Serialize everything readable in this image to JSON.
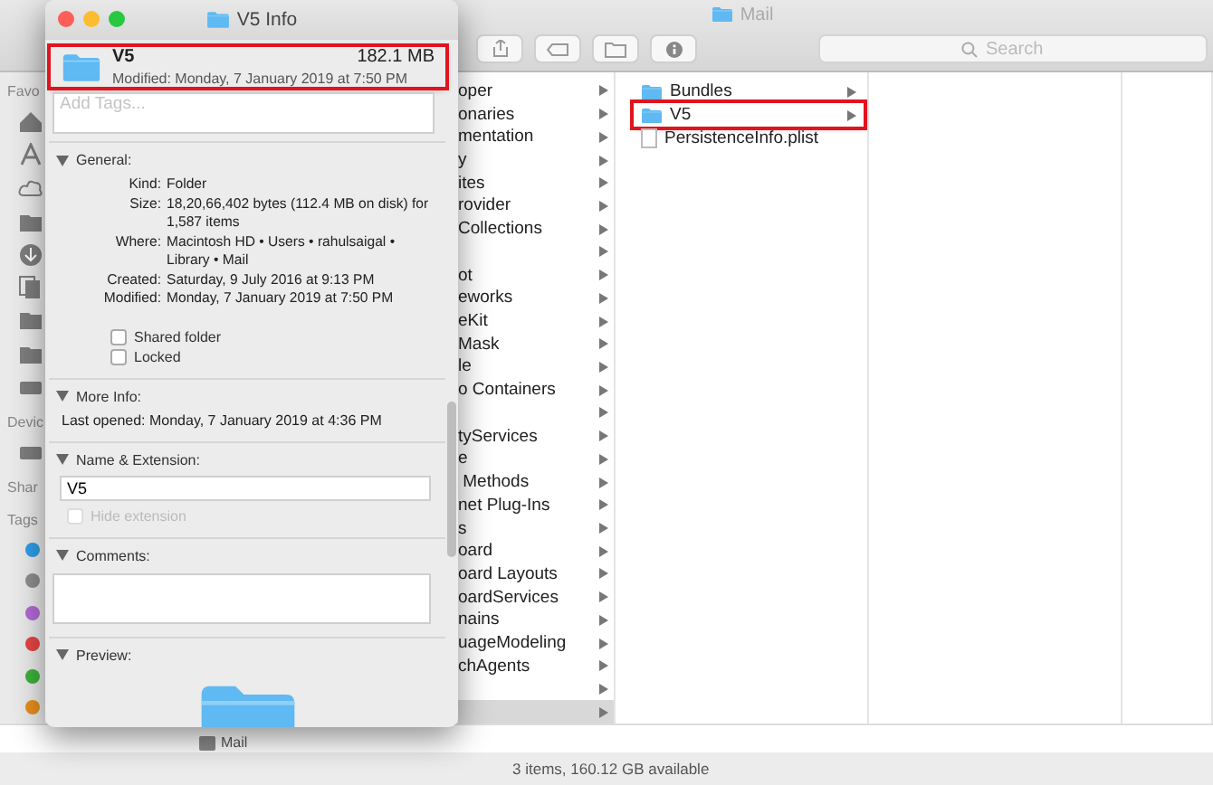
{
  "finder": {
    "title": "Mail",
    "search": {
      "placeholder": "Search"
    },
    "sidebar": {
      "sections": [
        "Favo",
        "Devic",
        "Shar",
        "Tags"
      ],
      "tags": [
        {
          "color": "#2f9ee8"
        },
        {
          "color": "#8e8e8e"
        },
        {
          "color": "#b36ad6"
        },
        {
          "color": "#e64545"
        },
        {
          "color": "#3bb33b"
        },
        {
          "color": "#e88e1e"
        }
      ]
    },
    "column_1": [
      {
        "label": "oper",
        "selected": false
      },
      {
        "label": "onaries",
        "selected": false
      },
      {
        "label": "mentation",
        "selected": false
      },
      {
        "label": "y",
        "selected": false
      },
      {
        "label": "ites",
        "selected": false
      },
      {
        "label": "rovider",
        "selected": false
      },
      {
        "label": "Collections",
        "selected": false
      },
      {
        "selected": false
      },
      {
        "label": "ot",
        "selected": false
      },
      {
        "label": "eworks",
        "selected": false
      },
      {
        "label": "eKit",
        "selected": false
      },
      {
        "label": "Mask",
        "selected": false
      },
      {
        "label": "le",
        "selected": false
      },
      {
        "label": "o Containers",
        "selected": false
      },
      {
        "selected": false
      },
      {
        "label": "tyServices",
        "selected": false
      },
      {
        "label": "e",
        "selected": false
      },
      {
        "label": " Methods",
        "selected": false
      },
      {
        "label": "net Plug-Ins",
        "selected": false
      },
      {
        "label": "s",
        "selected": false
      },
      {
        "label": "oard",
        "selected": false
      },
      {
        "label": "oard Layouts",
        "selected": false
      },
      {
        "label": "oardServices",
        "selected": false
      },
      {
        "label": "nains",
        "selected": false
      },
      {
        "label": "uageModeling",
        "selected": false
      },
      {
        "label": "chAgents",
        "selected": false
      },
      {
        "selected": false
      },
      {
        "selected": true
      }
    ],
    "column_2": [
      {
        "label": "Bundles",
        "kind": "folder",
        "highlighted": false
      },
      {
        "label": "V5",
        "kind": "folder",
        "highlighted": true
      },
      {
        "label": "PersistenceInfo.plist",
        "kind": "file",
        "highlighted": false
      }
    ],
    "path_bar": "Mail",
    "status_bar": "3 items, 160.12 GB available"
  },
  "info": {
    "title": "V5 Info",
    "header": {
      "name": "V5",
      "size": "182.1 MB",
      "modified": "Modified: Monday, 7 January 2019 at 7:50 PM",
      "highlighted": true
    },
    "tags": {
      "placeholder": "Add Tags..."
    },
    "general": {
      "heading": "General:",
      "expanded": true,
      "rows": [
        {
          "key": "Kind:",
          "value": "Folder"
        },
        {
          "key": "Size:",
          "value": "18,20,66,402 bytes (112.4 MB on disk) for 1,587 items"
        },
        {
          "key": "Where:",
          "value": "Macintosh HD • Users • rahulsaigal • Library • Mail"
        },
        {
          "key": "Created:",
          "value": "Saturday, 9 July 2016 at 9:13 PM"
        },
        {
          "key": "Modified:",
          "value": "Monday, 7 January 2019 at 7:50 PM"
        }
      ],
      "checkboxes": [
        {
          "label": "Shared folder",
          "checked": false,
          "disabled": false
        },
        {
          "label": "Locked",
          "checked": false,
          "disabled": false
        }
      ]
    },
    "more_info": {
      "heading": "More Info:",
      "expanded": true,
      "text": "Last opened: Monday, 7 January 2019 at 4:36 PM"
    },
    "name_extension": {
      "heading": "Name & Extension:",
      "expanded": true,
      "value": "V5",
      "checkbox": {
        "label": "Hide extension",
        "checked": false,
        "disabled": true
      }
    },
    "comments": {
      "heading": "Comments:",
      "expanded": true
    },
    "preview": {
      "heading": "Preview:",
      "expanded": true
    }
  }
}
